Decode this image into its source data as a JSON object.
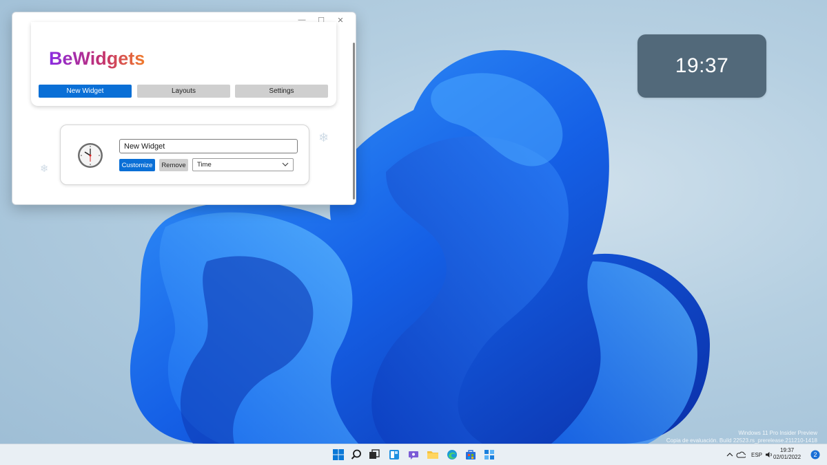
{
  "desktop": {
    "clock_widget": {
      "time": "19:37",
      "background": "#52697a"
    },
    "watermark": {
      "line1": "Windows 11 Pro Insider Preview",
      "line2": "Copia de evaluación. Build 22523.rs_prerelease.211210-1418"
    }
  },
  "app": {
    "logo": "BeWidgets",
    "window_controls": {
      "minimize": "—",
      "maximize": "☐",
      "close": "✕"
    },
    "nav": {
      "new_widget": "New Widget",
      "layouts": "Layouts",
      "settings": "Settings"
    },
    "widget": {
      "icon": "clock-icon",
      "name_value": "New Widget",
      "customize_label": "Customize",
      "remove_label": "Remove",
      "type_selected": "Time"
    },
    "colors": {
      "accent": "#0a6fd6",
      "secondary": "#cfcfcf"
    }
  },
  "taskbar": {
    "icons": [
      "start-icon",
      "search-icon",
      "task-view-icon",
      "widgets-icon",
      "chat-icon",
      "file-explorer-icon",
      "edge-icon",
      "store-icon",
      "bewidgets-icon"
    ],
    "tray": {
      "language": "ESP",
      "time": "19:37",
      "date": "02/01/2022"
    }
  }
}
